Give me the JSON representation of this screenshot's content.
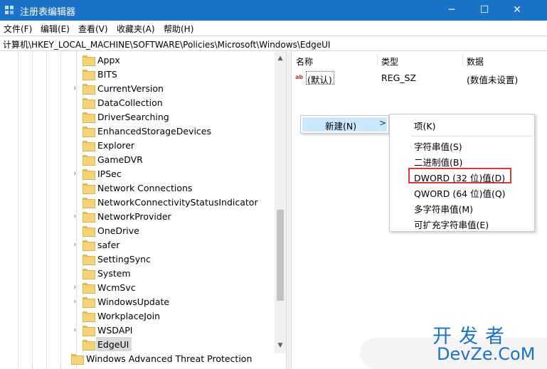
{
  "window": {
    "title": "注册表编辑器",
    "minimize_glyph": "─",
    "maximize_glyph": "☐",
    "close_glyph": "✕"
  },
  "menu": [
    "文件(F)",
    "编辑(E)",
    "查看(V)",
    "收藏夹(A)",
    "帮助(H)"
  ],
  "address": "计算机\\HKEY_LOCAL_MACHINE\\SOFTWARE\\Policies\\Microsoft\\Windows\\EdgeUI",
  "tree": {
    "items": [
      {
        "label": "Appx",
        "expandable": false
      },
      {
        "label": "BITS",
        "expandable": false
      },
      {
        "label": "CurrentVersion",
        "expandable": true
      },
      {
        "label": "DataCollection",
        "expandable": false
      },
      {
        "label": "DriverSearching",
        "expandable": false
      },
      {
        "label": "EnhancedStorageDevices",
        "expandable": false
      },
      {
        "label": "Explorer",
        "expandable": false
      },
      {
        "label": "GameDVR",
        "expandable": false
      },
      {
        "label": "IPSec",
        "expandable": true
      },
      {
        "label": "Network Connections",
        "expandable": false
      },
      {
        "label": "NetworkConnectivityStatusIndicator",
        "expandable": false
      },
      {
        "label": "NetworkProvider",
        "expandable": true
      },
      {
        "label": "OneDrive",
        "expandable": false
      },
      {
        "label": "safer",
        "expandable": true
      },
      {
        "label": "SettingSync",
        "expandable": false
      },
      {
        "label": "System",
        "expandable": false
      },
      {
        "label": "WcmSvc",
        "expandable": true
      },
      {
        "label": "WindowsUpdate",
        "expandable": true
      },
      {
        "label": "WorkplaceJoin",
        "expandable": false
      },
      {
        "label": "WSDAPI",
        "expandable": true
      },
      {
        "label": "EdgeUI",
        "expandable": false,
        "selected": true
      },
      {
        "label": "Windows Advanced Threat Protection",
        "expandable": false
      }
    ]
  },
  "list": {
    "columns": [
      "名称",
      "类型",
      "数据"
    ],
    "rows": [
      {
        "name": "(默认)",
        "type": "REG_SZ",
        "data": "(数值未设置)",
        "icon": "string-value-icon",
        "icon_text": "ab"
      }
    ]
  },
  "context_menu": {
    "new_label": "新建(N)",
    "arrow": ">",
    "submenu": [
      "项(K)",
      "字符串值(S)",
      "二进制值(B)",
      "DWORD (32 位)值(D)",
      "QWORD (64 位)值(Q)",
      "多字符串值(M)",
      "可扩充字符串值(E)"
    ],
    "highlighted_item": "DWORD (32 位)值(D)"
  },
  "watermark": {
    "top": "开发者",
    "bottom": "DevZe.CoM"
  },
  "colors": {
    "titlebar": "#1a73c7",
    "menu_highlight": "#cce8ff",
    "annotation_box": "#d03b34",
    "selection": "#d9d9d9"
  }
}
